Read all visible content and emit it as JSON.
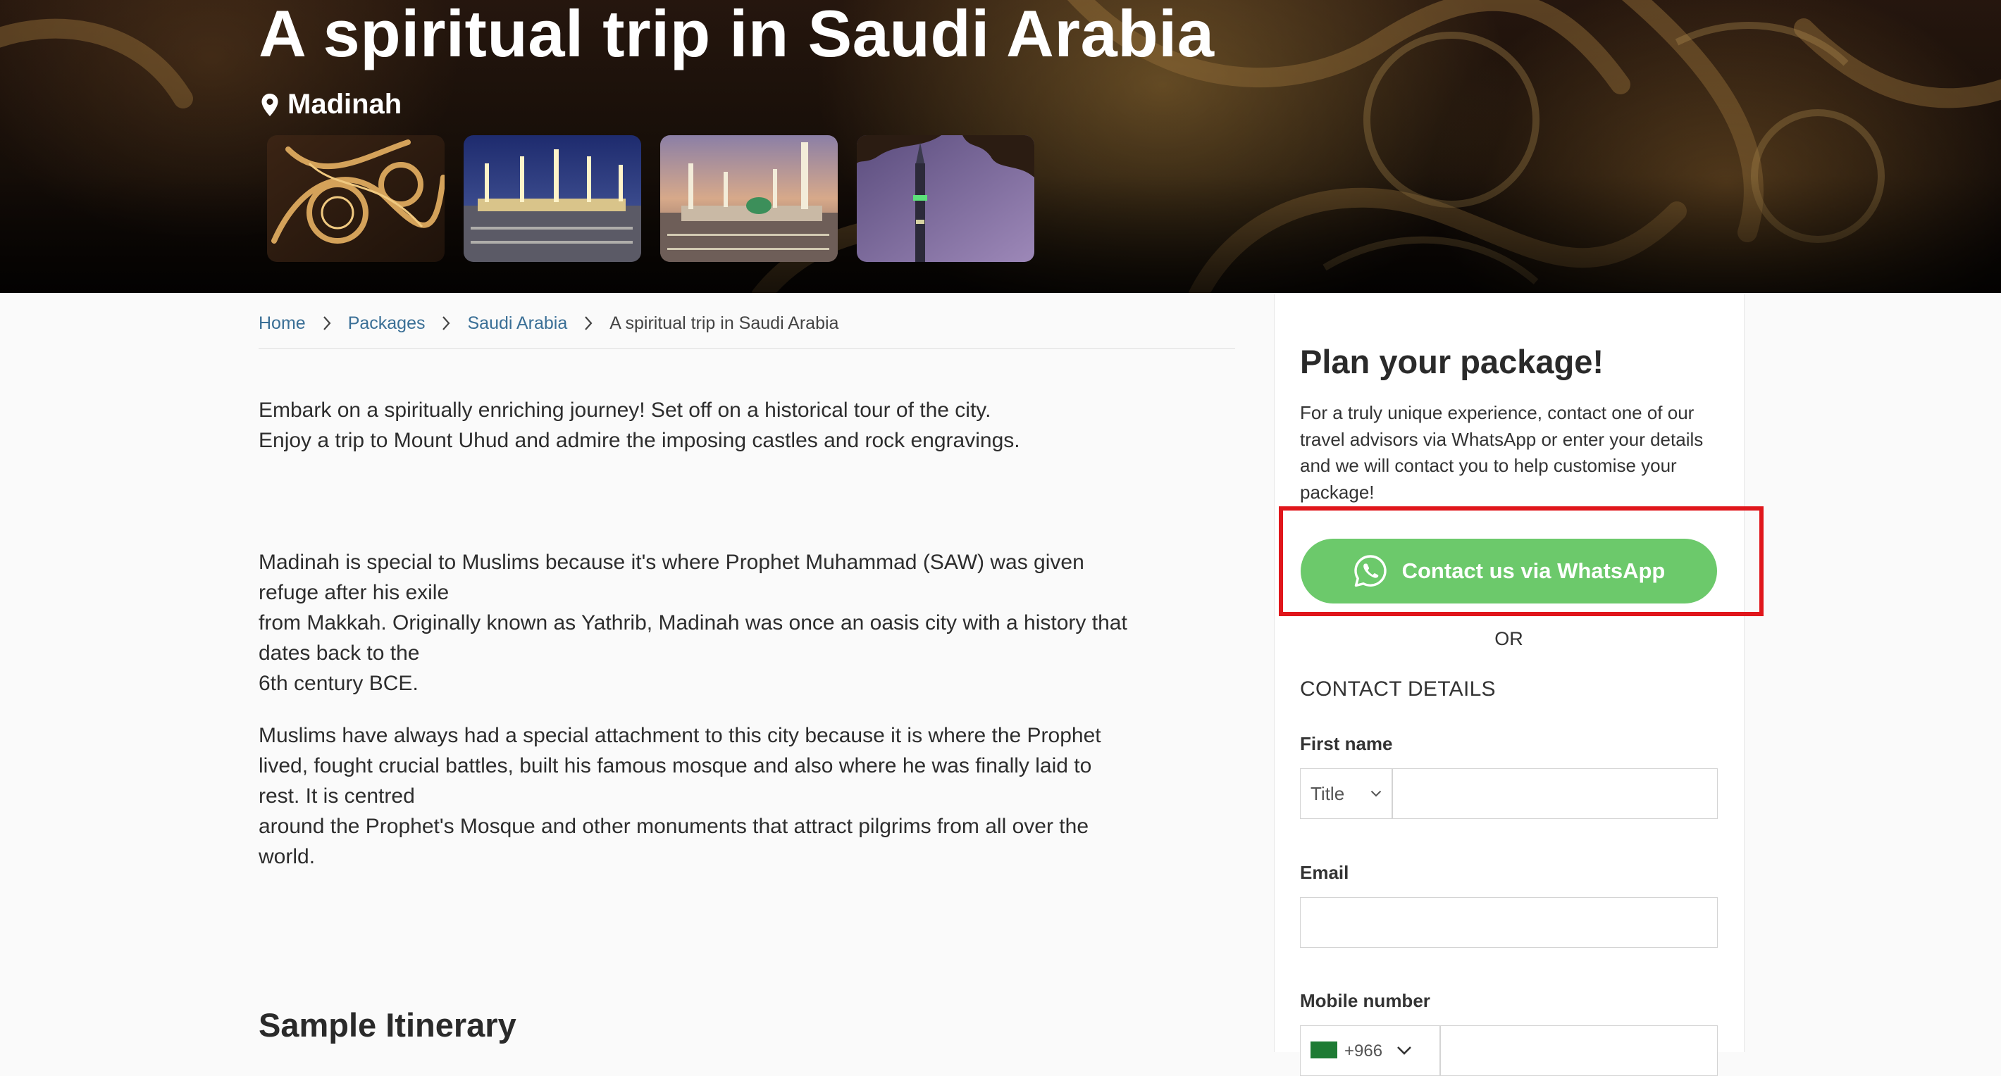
{
  "hero": {
    "title": "A spiritual trip in Saudi Arabia",
    "location": "Madinah",
    "thumbnails": [
      "calligraphy",
      "mosque-night",
      "mosque-dusk",
      "minaret-twilight"
    ]
  },
  "breadcrumb": {
    "items": [
      {
        "label": "Home"
      },
      {
        "label": "Packages"
      },
      {
        "label": "Saudi Arabia"
      },
      {
        "label": "A spiritual trip in Saudi Arabia"
      }
    ]
  },
  "content": {
    "intro_lines": [
      "Embark on a spiritually enriching journey! Set off on a historical tour of the city.",
      "Enjoy a trip to Mount Uhud and admire the imposing castles and rock engravings."
    ],
    "p2_lines": [
      "Madinah is special to Muslims because it's where Prophet Muhammad (SAW) was given",
      "refuge after his exile",
      "from Makkah. Originally known as Yathrib, Madinah was once an oasis city with a history that",
      "dates back to the",
      "6th century BCE."
    ],
    "p3_lines": [
      "Muslims have always had a special attachment to this city because it is where the Prophet",
      "lived, fought crucial battles, built his famous mosque and also where he was finally laid to",
      "rest. It is centred",
      "around the Prophet's Mosque and other monuments that attract pilgrims from all over the",
      "world."
    ],
    "itinerary_heading": "Sample Itinerary"
  },
  "sidebar": {
    "title": "Plan your package!",
    "description": "For a truly unique experience, contact one of our travel advisors via WhatsApp or enter your details and we will contact you to help customise your package!",
    "whatsapp_button": "Contact us via WhatsApp",
    "or_text": "OR",
    "contact_heading": "CONTACT DETAILS",
    "first_name_label": "First name",
    "title_select": "Title",
    "email_label": "Email",
    "mobile_label": "Mobile number",
    "country_code": "+966"
  },
  "colors": {
    "whatsapp_green": "#6cc96b",
    "link_blue": "#3a6f96",
    "highlight_red": "#e0161b"
  }
}
